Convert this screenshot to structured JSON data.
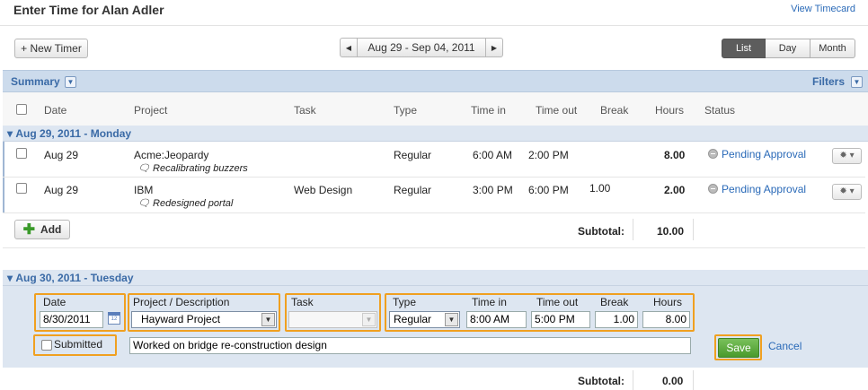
{
  "header": {
    "title": "Enter Time for Alan Adler",
    "view_timecard": "View Timecard"
  },
  "toolbar": {
    "new_timer": "+ New Timer",
    "date_range": "Aug 29 - Sep 04, 2011",
    "views": [
      "List",
      "Day",
      "Month"
    ],
    "active_view": "List"
  },
  "summary": {
    "label": "Summary",
    "filters": "Filters"
  },
  "columns": [
    "Date",
    "Project",
    "Task",
    "Type",
    "Time in",
    "Time out",
    "Break",
    "Hours",
    "Status"
  ],
  "days": [
    {
      "label": "Aug 29, 2011 - Monday",
      "entries": [
        {
          "date": "Aug 29",
          "project": "Acme:Jeopardy",
          "note": "Recalibrating buzzers",
          "task": "",
          "type": "Regular",
          "time_in": "6:00 AM",
          "time_out": "2:00 PM",
          "break": "",
          "hours": "8.00",
          "status": "Pending Approval"
        },
        {
          "date": "Aug 29",
          "project": "IBM",
          "note": "Redesigned portal",
          "task": "Web Design",
          "type": "Regular",
          "time_in": "3:00 PM",
          "time_out": "6:00 PM",
          "break": "1.00",
          "hours": "2.00",
          "status": "Pending Approval"
        }
      ],
      "add_label": "Add",
      "subtotal_label": "Subtotal:",
      "subtotal": "10.00"
    },
    {
      "label": "Aug 30, 2011 - Tuesday",
      "subtotal_label": "Subtotal:",
      "subtotal": "0.00"
    }
  ],
  "edit_form": {
    "labels": {
      "date": "Date",
      "project": "Project / Description",
      "task": "Task",
      "type": "Type",
      "time_in": "Time in",
      "time_out": "Time out",
      "break": "Break",
      "hours": "Hours",
      "submitted": "Submitted"
    },
    "values": {
      "date": "8/30/2011",
      "project": "Hayward Project",
      "task": "",
      "type": "Regular",
      "time_in": "8:00 AM",
      "time_out": "5:00 PM",
      "break": "1.00",
      "hours": "8.00",
      "description": "Worked on bridge re-construction design"
    },
    "save": "Save",
    "cancel": "Cancel"
  },
  "colors": {
    "accent": "#3a6aa6",
    "highlight": "#f0a020",
    "save_green": "#4a9a2c"
  }
}
